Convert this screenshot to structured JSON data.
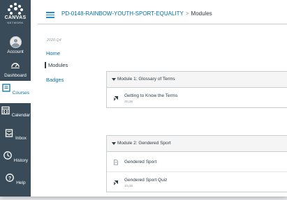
{
  "app": {
    "logo_title": "CANVAS",
    "logo_subtitle": "NETWORK"
  },
  "global_nav": {
    "items": [
      {
        "label": "Account",
        "icon": "account-avatar"
      },
      {
        "label": "Dashboard",
        "icon": "dashboard-icon"
      },
      {
        "label": "Courses",
        "icon": "courses-icon",
        "active": true
      },
      {
        "label": "Calendar",
        "icon": "calendar-icon"
      },
      {
        "label": "Inbox",
        "icon": "inbox-icon"
      },
      {
        "label": "History",
        "icon": "history-icon"
      },
      {
        "label": "Help",
        "icon": "help-icon"
      }
    ]
  },
  "header": {
    "course_link": "PD-0148-RAINBOW-YOUTH-SPORT-EQUALITY",
    "separator": ">",
    "current": "Modules"
  },
  "course_nav": {
    "term": "2020-Q4",
    "items": [
      {
        "label": "Home"
      },
      {
        "label": "Modules",
        "active": true
      },
      {
        "label": "Badges"
      }
    ]
  },
  "modules": [
    {
      "title": "Module 1: Glossary of Terms",
      "items": [
        {
          "name": "Getting to Know the Terms",
          "points": "25 pts",
          "icon": "quiz-rocket-icon"
        }
      ]
    },
    {
      "title": "Module 2: Gendered Sport",
      "items": [
        {
          "name": "Gendered Sport",
          "points": "",
          "icon": "page-icon"
        },
        {
          "name": "Gendered Sport Quiz",
          "points": "10 pts",
          "icon": "quiz-rocket-icon"
        }
      ]
    }
  ],
  "colors": {
    "nav_bg": "#394b58",
    "link": "#0770a3",
    "accent": "#0b874b"
  }
}
